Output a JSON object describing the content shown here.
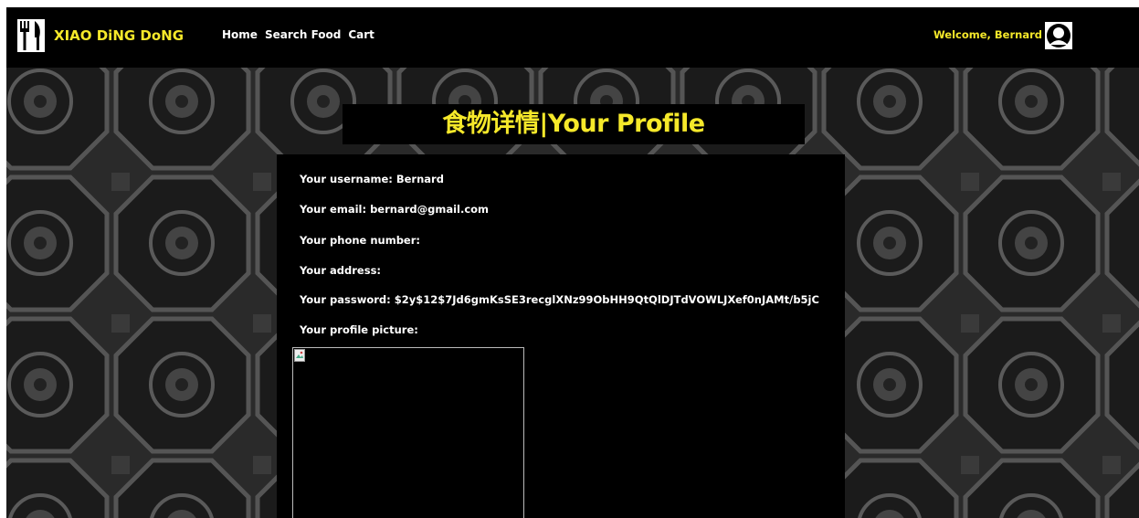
{
  "navbar": {
    "brand": "XIAO DiNG DoNG",
    "brand_icon": "fork-knife-icon",
    "links": [
      "Home",
      "Search Food",
      "Cart"
    ],
    "welcome": "Welcome, Bernard",
    "avatar_icon": "user-avatar-icon"
  },
  "colors": {
    "accent": "#f5e82a",
    "background": "#000000",
    "text": "#ffffff"
  },
  "profile": {
    "title": "食物详情|Your Profile",
    "fields": [
      "Your username: Bernard",
      "Your email: bernard@gmail.com",
      "Your phone number:",
      "Your address:",
      "Your password: $2y$12$7Jd6gmKsSE3recglXNz99ObHH9QtQlDJTdVOWLJXef0nJAMt/b5jC",
      "Your profile picture:"
    ],
    "picture_icon": "broken-image-icon"
  }
}
